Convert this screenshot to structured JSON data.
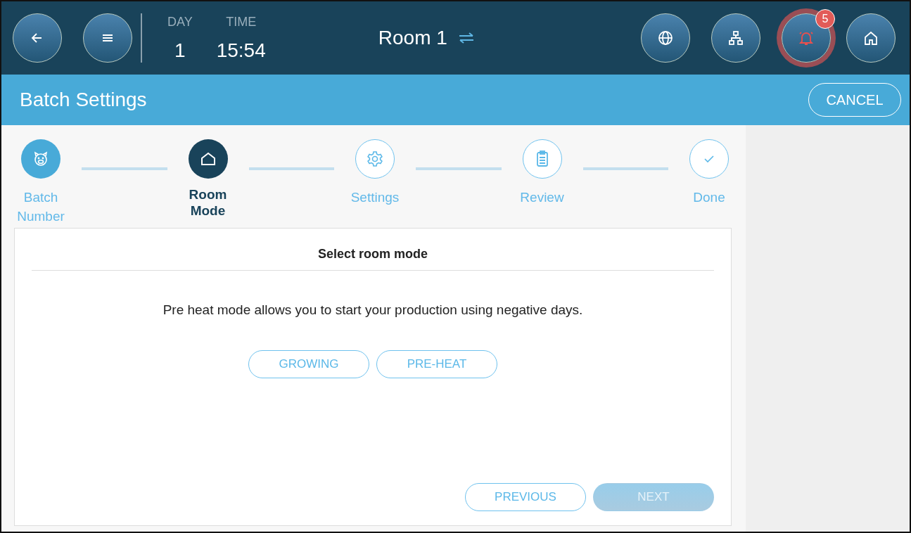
{
  "header": {
    "day_label": "DAY",
    "day": "1",
    "time_label": "TIME",
    "time": "15:54",
    "room": "Room 1",
    "alarm_count": "5",
    "alarm_active": true
  },
  "titlebar": {
    "title": "Batch Settings",
    "cancel": "CANCEL"
  },
  "steps": [
    {
      "label": "Batch Number",
      "completed": true,
      "selected": false
    },
    {
      "label": "Room Mode",
      "completed": false,
      "selected": true
    },
    {
      "label": "Settings",
      "completed": false,
      "selected": false
    },
    {
      "label": "Review",
      "completed": false,
      "selected": false
    },
    {
      "label": "Done",
      "completed": false,
      "selected": false
    }
  ],
  "card": {
    "title": "Select room mode",
    "description": "Pre heat mode allows you to start your production using negative days.",
    "modes": [
      {
        "label": "GROWING",
        "selected": false
      },
      {
        "label": "PRE-HEAT",
        "selected": false
      }
    ],
    "previous": {
      "label": "PREVIOUS",
      "disabled": false
    },
    "next": {
      "label": "NEXT",
      "disabled": true
    }
  }
}
